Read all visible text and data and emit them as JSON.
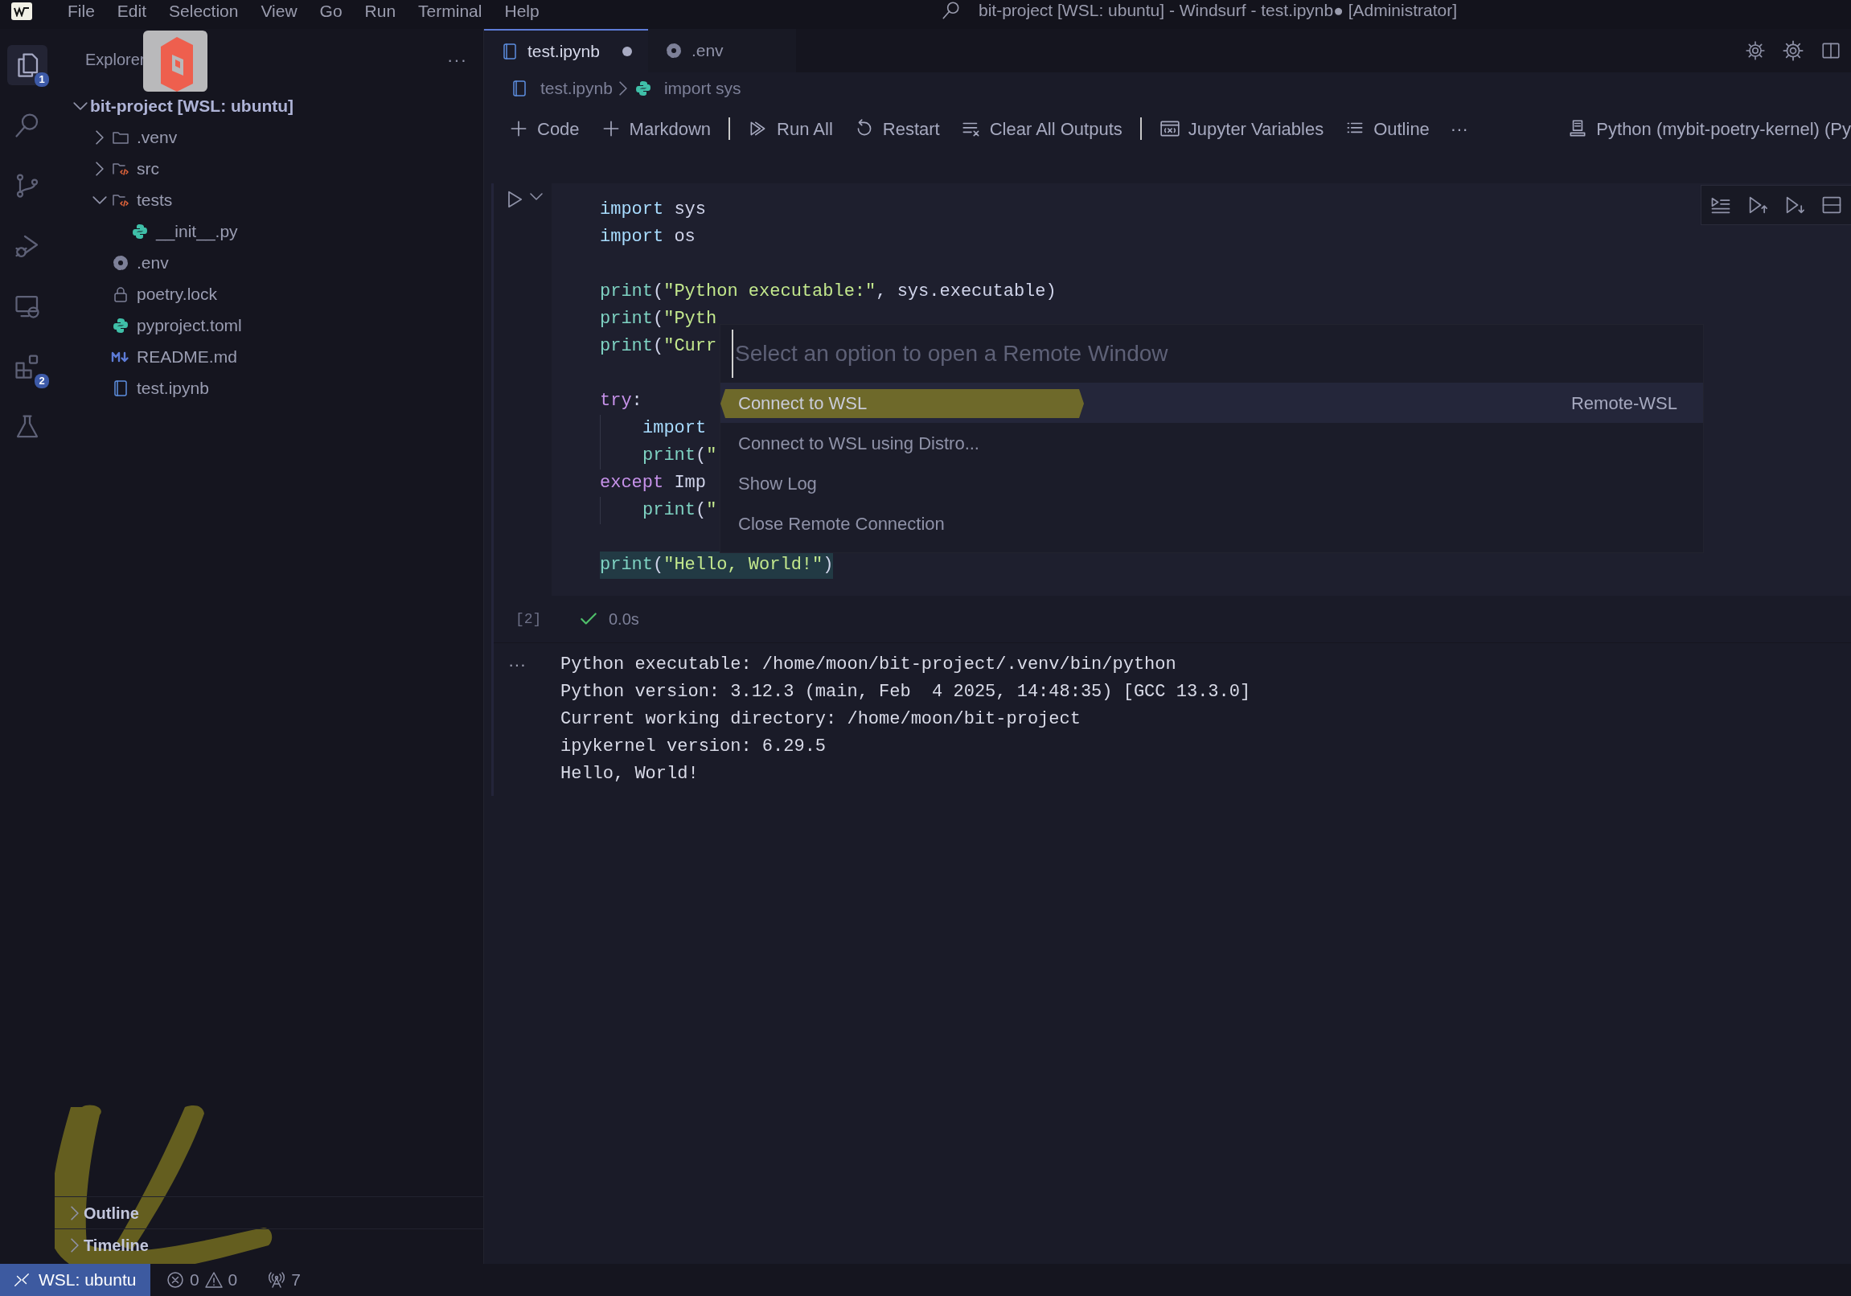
{
  "menu": [
    "File",
    "Edit",
    "Selection",
    "View",
    "Go",
    "Run",
    "Terminal",
    "Help"
  ],
  "title": "bit-project [WSL: ubuntu] - Windsurf - test.ipynb● [Administrator]",
  "activity_bar": [
    {
      "selected": true,
      "badge": "1"
    },
    {
      "selected": false
    },
    {
      "selected": false
    },
    {
      "selected": false
    },
    {
      "selected": false
    },
    {
      "selected": false,
      "badge": "2"
    },
    {
      "selected": false
    }
  ],
  "explorer": {
    "title": "Explorer",
    "more": "···",
    "root": {
      "label": "bit-project [WSL: ubuntu]",
      "expanded": true,
      "children": [
        {
          "label": ".venv",
          "kind": "folder",
          "expanded": false
        },
        {
          "label": "src",
          "kind": "code-folder",
          "expanded": false
        },
        {
          "label": "tests",
          "kind": "code-folder",
          "expanded": true,
          "children": [
            {
              "label": "__init__.py",
              "kind": "python"
            }
          ]
        },
        {
          "label": ".env",
          "kind": "settings"
        },
        {
          "label": "poetry.lock",
          "kind": "lock"
        },
        {
          "label": "pyproject.toml",
          "kind": "python"
        },
        {
          "label": "README.md",
          "kind": "markdown"
        },
        {
          "label": "test.ipynb",
          "kind": "notebook"
        }
      ]
    },
    "panels": [
      {
        "label": "Outline",
        "expanded": false
      },
      {
        "label": "Timeline",
        "expanded": false
      }
    ]
  },
  "tabs": [
    {
      "label": "test.ipynb",
      "kind": "notebook",
      "selected": true,
      "modified": true
    },
    {
      "label": ".env",
      "kind": "settings",
      "selected": false,
      "modified": false
    }
  ],
  "breadcrumb": [
    {
      "label": "test.ipynb",
      "kind": "notebook"
    },
    {
      "label": "import sys",
      "kind": "python"
    }
  ],
  "toolbar": [
    {
      "label": "Code",
      "separator_before": false
    },
    {
      "label": "Markdown",
      "separator_before": false
    },
    {
      "label": "Run All",
      "separator_before": true
    },
    {
      "label": "Restart",
      "separator_before": false
    },
    {
      "label": "Clear All Outputs",
      "separator_before": false
    },
    {
      "label": "Jupyter Variables",
      "separator_before": true
    },
    {
      "label": "Outline",
      "separator_before": false
    }
  ],
  "toolbar_more": "···",
  "kernel": "Python (mybit-poetry-kernel) (Py",
  "cell": {
    "code": [
      {
        "kind": "code",
        "indented": false,
        "highlighted": false,
        "tokens": [
          {
            "kind": "keyword",
            "text": "import"
          },
          {
            "kind": "plain",
            "text": " sys"
          }
        ]
      },
      {
        "kind": "code",
        "indented": false,
        "highlighted": false,
        "tokens": [
          {
            "kind": "keyword",
            "text": "import"
          },
          {
            "kind": "plain",
            "text": " os"
          }
        ]
      },
      {
        "kind": "blank"
      },
      {
        "kind": "code",
        "indented": false,
        "highlighted": false,
        "tokens": [
          {
            "kind": "function",
            "text": "print"
          },
          {
            "kind": "plain",
            "text": "("
          },
          {
            "kind": "string",
            "text": "\"Python executable:\""
          },
          {
            "kind": "plain",
            "text": ", sys.executable)"
          }
        ]
      },
      {
        "kind": "code",
        "indented": false,
        "highlighted": false,
        "tokens": [
          {
            "kind": "function",
            "text": "print"
          },
          {
            "kind": "plain",
            "text": "("
          },
          {
            "kind": "string",
            "text": "\"Pyth"
          }
        ]
      },
      {
        "kind": "code",
        "indented": false,
        "highlighted": false,
        "tokens": [
          {
            "kind": "function",
            "text": "print"
          },
          {
            "kind": "plain",
            "text": "("
          },
          {
            "kind": "string",
            "text": "\"Curr"
          }
        ]
      },
      {
        "kind": "blank"
      },
      {
        "kind": "code",
        "indented": false,
        "highlighted": false,
        "tokens": [
          {
            "kind": "control",
            "text": "try"
          },
          {
            "kind": "plain",
            "text": ":"
          }
        ]
      },
      {
        "kind": "code",
        "indented": true,
        "highlighted": false,
        "tokens": [
          {
            "kind": "keyword",
            "text": "import"
          }
        ]
      },
      {
        "kind": "code",
        "indented": true,
        "highlighted": false,
        "tokens": [
          {
            "kind": "function",
            "text": "print"
          },
          {
            "kind": "plain",
            "text": "("
          },
          {
            "kind": "string",
            "text": "\""
          }
        ]
      },
      {
        "kind": "code",
        "indented": false,
        "highlighted": false,
        "tokens": [
          {
            "kind": "control",
            "text": "except"
          },
          {
            "kind": "plain",
            "text": " Imp"
          }
        ]
      },
      {
        "kind": "code",
        "indented": true,
        "highlighted": false,
        "tokens": [
          {
            "kind": "function",
            "text": "print"
          },
          {
            "kind": "plain",
            "text": "("
          },
          {
            "kind": "string",
            "text": "\""
          }
        ]
      },
      {
        "kind": "blank"
      },
      {
        "kind": "code",
        "indented": false,
        "highlighted": true,
        "tokens": [
          {
            "kind": "function",
            "text": "print"
          },
          {
            "kind": "plain",
            "text": "("
          },
          {
            "kind": "string",
            "text": "\"Hello, World!\""
          },
          {
            "kind": "plain",
            "text": ")"
          }
        ]
      }
    ],
    "execution_count": "[2]",
    "succeeded": true,
    "duration": "0.0s",
    "output_marker": "···",
    "output": [
      "Python executable: /home/moon/bit-project/.venv/bin/python",
      "Python version: 3.12.3 (main, Feb  4 2025, 14:48:35) [GCC 13.3.0]",
      "Current working directory: /home/moon/bit-project",
      "ipykernel version: 6.29.5",
      "Hello, World!"
    ]
  },
  "quick_pick": {
    "placeholder": "Select an option to open a Remote Window",
    "items": [
      {
        "label": "Connect to WSL",
        "detail": "Remote-WSL",
        "selected": true
      },
      {
        "label": "Connect to WSL using Distro...",
        "selected": false
      },
      {
        "label": "Show Log",
        "selected": false
      },
      {
        "label": "Close Remote Connection",
        "selected": false
      }
    ]
  },
  "status_bar": {
    "remote": "WSL: ubuntu",
    "errors": "0",
    "warnings": "0",
    "ports": "7"
  }
}
